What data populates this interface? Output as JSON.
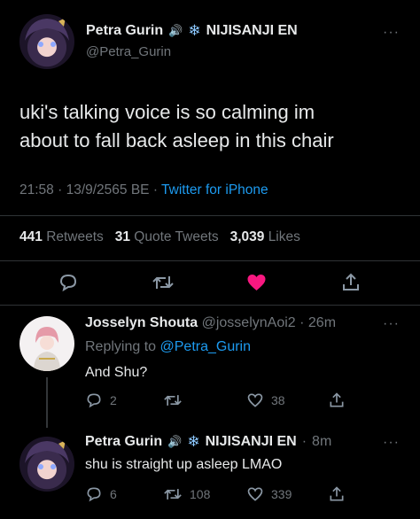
{
  "main_tweet": {
    "author_name": "Petra Gurin",
    "author_badge": "NIJISANJI EN",
    "handle": "@Petra_Gurin",
    "text_line1": "uki's talking voice is so calming im",
    "text_line2": "about to fall back asleep in this chair",
    "time": "21:58",
    "date": "13/9/2565 BE",
    "client": "Twitter for iPhone",
    "retweets_count": "441",
    "retweets_label": "Retweets",
    "quotes_count": "31",
    "quotes_label": "Quote Tweets",
    "likes_count": "3,039",
    "likes_label": "Likes"
  },
  "replies": [
    {
      "author_name": "Josselyn Shouta",
      "handle": "@josselynAoi2",
      "age": "26m",
      "replying_prefix": "Replying to",
      "replying_to": "@Petra_Gurin",
      "text": "And Shu?",
      "reply_count": "2",
      "retweet_count": "",
      "like_count": "38"
    },
    {
      "author_name": "Petra Gurin",
      "author_badge": "NIJISANJI EN",
      "age": "8m",
      "text": "shu is straight up asleep LMAO",
      "reply_count": "6",
      "retweet_count": "108",
      "like_count": "339"
    }
  ],
  "colors": {
    "accent": "#1d9bf0",
    "like": "#f91880",
    "muted": "#71767b",
    "text": "#e7e9ea",
    "bg": "#000000"
  }
}
